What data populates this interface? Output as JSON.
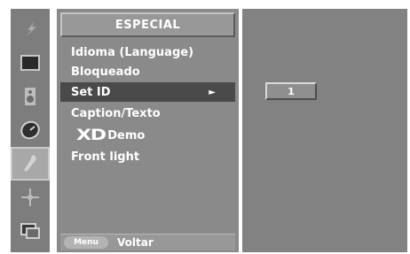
{
  "icons": [
    {
      "name": "picture-icon"
    },
    {
      "name": "screen-icon"
    },
    {
      "name": "sound-icon"
    },
    {
      "name": "time-icon"
    },
    {
      "name": "special-icon",
      "active": true
    },
    {
      "name": "setup-icon"
    },
    {
      "name": "pip-icon"
    }
  ],
  "menu": {
    "title": "ESPECIAL",
    "items": [
      {
        "label": "Idioma (Language)"
      },
      {
        "label": "Bloqueado"
      },
      {
        "label": "Set ID",
        "selected": true,
        "arrow": "►"
      },
      {
        "label": "Caption/Texto"
      },
      {
        "logo": "XD",
        "label": "Demo"
      },
      {
        "label": "Front light"
      }
    ],
    "footer": {
      "button": "Menu",
      "label": "Voltar"
    }
  },
  "set_id": {
    "value": "1"
  }
}
